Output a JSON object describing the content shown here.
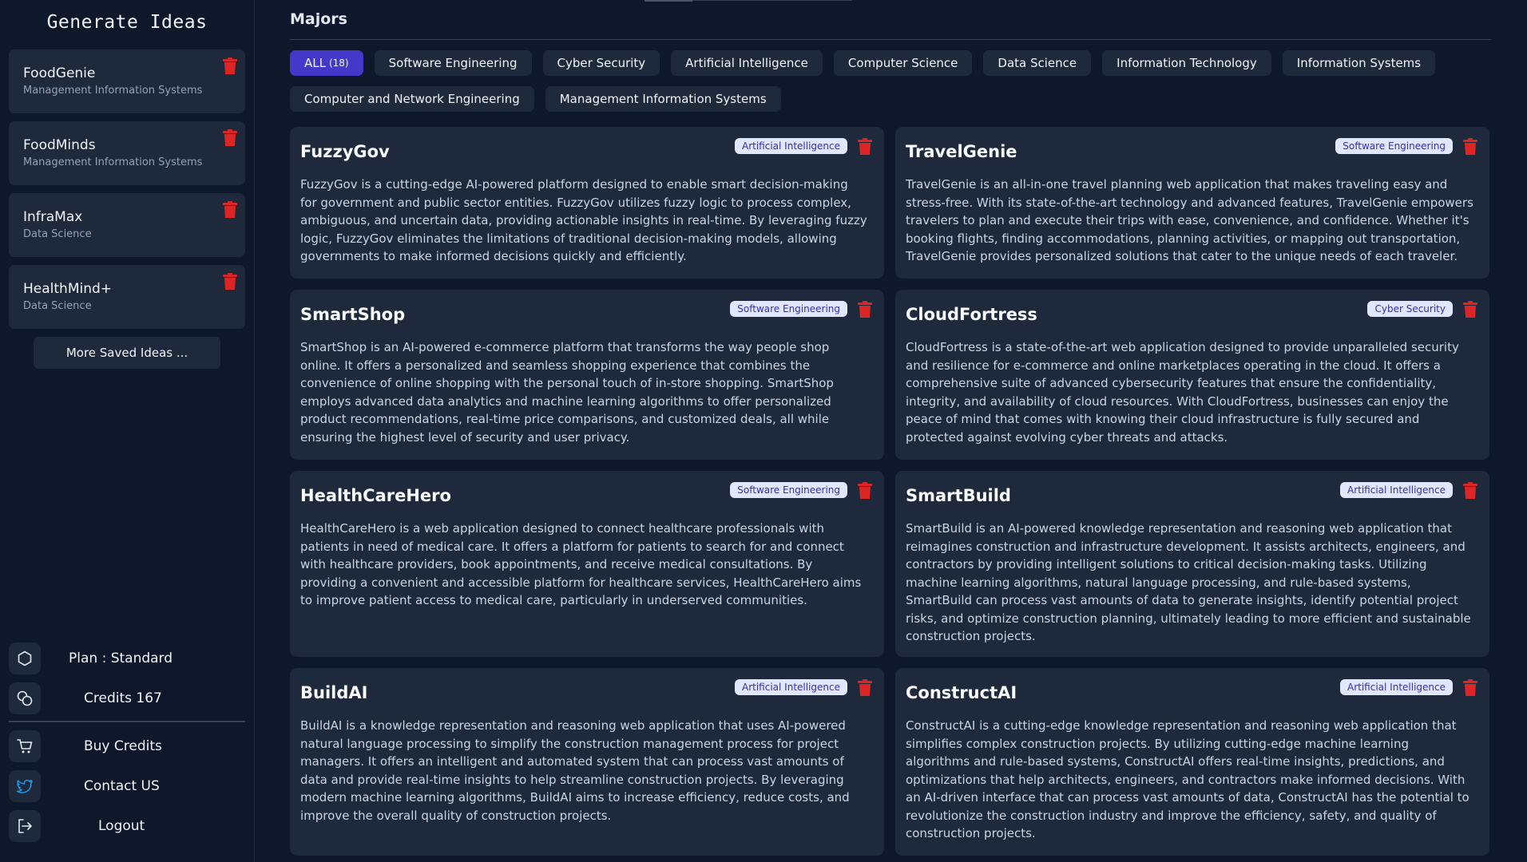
{
  "sidebar": {
    "title": "Generate Ideas",
    "saved": [
      {
        "name": "FoodGenie",
        "major": "Management Information Systems"
      },
      {
        "name": "FoodMinds",
        "major": "Management Information Systems"
      },
      {
        "name": "InfraMax",
        "major": "Data Science"
      },
      {
        "name": "HealthMind+",
        "major": "Data Science"
      }
    ],
    "more_label": "More Saved Ideas ...",
    "plan_label": "Plan : Standard",
    "credits_label": "Credits 167",
    "buy_label": "Buy Credits",
    "contact_label": "Contact US",
    "logout_label": "Logout"
  },
  "main": {
    "section_title": "Majors",
    "filters": [
      {
        "label": "ALL",
        "count": "(18)",
        "active": true
      },
      {
        "label": "Software Engineering"
      },
      {
        "label": "Cyber Security"
      },
      {
        "label": "Artificial Intelligence"
      },
      {
        "label": "Computer Science"
      },
      {
        "label": "Data Science"
      },
      {
        "label": "Information Technology"
      },
      {
        "label": "Information Systems"
      },
      {
        "label": "Computer and Network Engineering"
      },
      {
        "label": "Management Information Systems"
      }
    ],
    "cards": [
      {
        "title": "FuzzyGov",
        "badge": "Artificial Intelligence",
        "desc": "FuzzyGov is a cutting-edge AI-powered platform designed to enable smart decision-making for government and public sector entities. FuzzyGov utilizes fuzzy logic to process complex, ambiguous, and uncertain data, providing actionable insights in real-time. By leveraging fuzzy logic, FuzzyGov eliminates the limitations of traditional decision-making models, allowing governments to make informed decisions quickly and efficiently."
      },
      {
        "title": "TravelGenie",
        "badge": "Software Engineering",
        "desc": "TravelGenie is an all-in-one travel planning web application that makes traveling easy and stress-free. With its state-of-the-art technology and advanced features, TravelGenie empowers travelers to plan and execute their trips with ease, convenience, and confidence. Whether it's booking flights, finding accommodations, planning activities, or mapping out transportation, TravelGenie provides personalized solutions that cater to the unique needs of each traveler."
      },
      {
        "title": "SmartShop",
        "badge": "Software Engineering",
        "desc": "SmartShop is an AI-powered e-commerce platform that transforms the way people shop online. It offers a personalized and seamless shopping experience that combines the convenience of online shopping with the personal touch of in-store shopping. SmartShop employs advanced data analytics and machine learning algorithms to offer personalized product recommendations, real-time price comparisons, and customized deals, all while ensuring the highest level of security and user privacy."
      },
      {
        "title": "CloudFortress",
        "badge": "Cyber Security",
        "desc": "CloudFortress is a state-of-the-art web application designed to provide unparalleled security and resilience for e-commerce and online marketplaces operating in the cloud. It offers a comprehensive suite of advanced cybersecurity features that ensure the confidentiality, integrity, and availability of cloud resources. With CloudFortress, businesses can enjoy the peace of mind that comes with knowing their cloud infrastructure is fully secured and protected against evolving cyber threats and attacks."
      },
      {
        "title": "HealthCareHero",
        "badge": "Software Engineering",
        "desc": "HealthCareHero is a web application designed to connect healthcare professionals with patients in need of medical care. It offers a platform for patients to search for and connect with healthcare providers, book appointments, and receive medical consultations. By providing a convenient and accessible platform for healthcare services, HealthCareHero aims to improve patient access to medical care, particularly in underserved communities."
      },
      {
        "title": "SmartBuild",
        "badge": "Artificial Intelligence",
        "desc": "SmartBuild is an AI-powered knowledge representation and reasoning web application that reimagines construction and infrastructure development. It assists architects, engineers, and contractors by providing intelligent solutions to critical decision-making tasks. Utilizing machine learning algorithms, natural language processing, and rule-based systems, SmartBuild can process vast amounts of data to generate insights, identify potential project risks, and optimize construction planning, ultimately leading to more efficient and sustainable construction projects."
      },
      {
        "title": "BuildAI",
        "badge": "Artificial Intelligence",
        "desc": "BuildAI is a knowledge representation and reasoning web application that uses AI-powered natural language processing to simplify the construction management process for project managers. It offers an intelligent and automated system that can process vast amounts of data and provide real-time insights to help streamline construction projects. By leveraging modern machine learning algorithms, BuildAI aims to increase efficiency, reduce costs, and improve the overall quality of construction projects."
      },
      {
        "title": "ConstructAI",
        "badge": "Artificial Intelligence",
        "desc": "ConstructAI is a cutting-edge knowledge representation and reasoning web application that simplifies complex construction projects. By utilizing cutting-edge machine learning algorithms and rule-based systems, ConstructAI offers real-time insights, predictions, and optimizations that help architects, engineers, and contractors make informed decisions. With an AI-driven interface that can process vast amounts of data, ConstructAI has the potential to revolutionize the construction industry and improve the efficiency, safety, and quality of construction projects."
      }
    ]
  },
  "colors": {
    "background": "#0f172a",
    "surface": "#1e293b",
    "accent": "#4338ca",
    "danger": "#dc2626",
    "badge_bg": "#e0e7ff",
    "badge_text": "#3730a3",
    "twitter": "#1d9bf0"
  },
  "icons": {
    "delete": "trash-icon",
    "plan": "hexagon-icon",
    "credits": "coins-icon",
    "buy": "cart-icon",
    "contact": "twitter-icon",
    "logout": "logout-icon"
  }
}
